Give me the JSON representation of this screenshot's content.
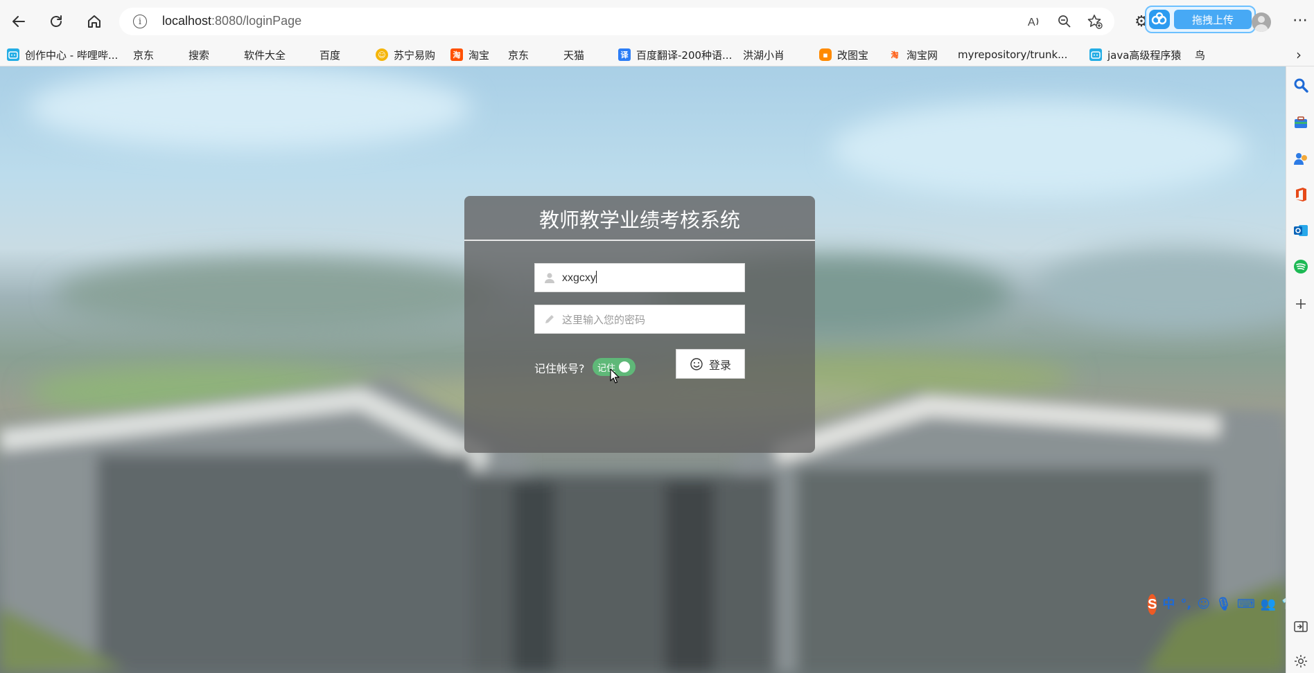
{
  "browser": {
    "url_host": "localhost",
    "url_path": ":8080/loginPage",
    "extension_label": "拖拽上传",
    "bookmarks": [
      {
        "label": "创作中心 - 哔哩哔...",
        "icon": "bilibili-icon",
        "color": "#23ade5"
      },
      {
        "label": "京东",
        "icon": "page-icon"
      },
      {
        "label": "搜索",
        "icon": "page-icon"
      },
      {
        "label": "软件大全",
        "icon": "page-icon"
      },
      {
        "label": "百度",
        "icon": "baidu-paw-icon",
        "color": "#2932e1"
      },
      {
        "label": "苏宁易购",
        "icon": "suning-icon",
        "color": "#f5b50a"
      },
      {
        "label": "淘宝",
        "icon": "taobao-icon",
        "color": "#ff5000"
      },
      {
        "label": "京东",
        "icon": "page-icon"
      },
      {
        "label": "天猫",
        "icon": "page-icon"
      },
      {
        "label": "百度翻译-200种语...",
        "icon": "translate-icon",
        "color": "#2c7df6"
      },
      {
        "label": "洪湖小肖",
        "icon": "feather-icon",
        "color": "#777777"
      },
      {
        "label": "改图宝",
        "icon": "gaitubao-icon",
        "color": "#ff8a00"
      },
      {
        "label": "淘宝网",
        "icon": "taobao-icon",
        "color": "#ff5000"
      },
      {
        "label": "myrepository/trunk...",
        "icon": "chrome-icon",
        "color": "#db4437"
      },
      {
        "label": "java高级程序猿",
        "icon": "bilibili-icon",
        "color": "#23ade5"
      },
      {
        "label": "鸟",
        "icon": "bird-icon",
        "color": "#e0282e"
      }
    ]
  },
  "login": {
    "title": "教师教学业绩考核系统",
    "username_value": "xxgcxy",
    "password_placeholder": "这里输入您的密码",
    "remember_label": "记住帐号?",
    "toggle_text": "记住",
    "toggle_on": true,
    "login_button": "登录"
  },
  "ime": {
    "logo": "S",
    "mode": "中",
    "punct": "°,"
  },
  "colors": {
    "toggle_on": "#5fb878",
    "panel": "rgba(96,96,96,0.78)",
    "accent_blue": "#1e6ad6"
  }
}
